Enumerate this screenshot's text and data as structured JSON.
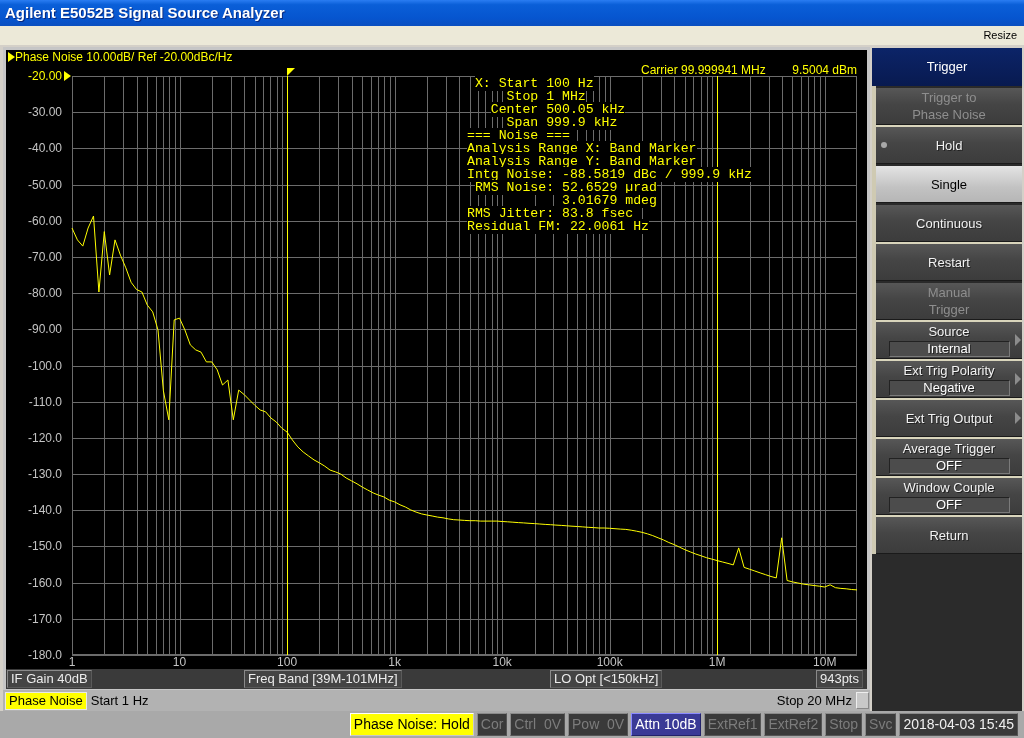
{
  "window": {
    "title": "Agilent E5052B Signal Source Analyzer"
  },
  "menu_bar": {
    "items": [
      "Resize"
    ]
  },
  "chart_panel": {
    "carrier": {
      "frequency": "Carrier 99.999941 MHz",
      "power": "9.5004 dBm"
    },
    "chart_data": {
      "type": "line",
      "title": "Phase Noise 10.00dB/ Ref -20.00dBc/Hz",
      "grid": true,
      "categories": [
        "1",
        null,
        null,
        null,
        null,
        null,
        null,
        null,
        null,
        null,
        null,
        null,
        null,
        null,
        null,
        null,
        null,
        null,
        null,
        null,
        "10",
        null,
        null,
        null,
        null,
        null,
        null,
        null,
        null,
        null,
        null,
        null,
        null,
        null,
        null,
        null,
        null,
        null,
        null,
        null,
        "100",
        null,
        null,
        null,
        null,
        null,
        null,
        null,
        null,
        null,
        null,
        null,
        null,
        null,
        null,
        null,
        null,
        null,
        null,
        null,
        "1k",
        null,
        null,
        null,
        null,
        null,
        null,
        null,
        null,
        null,
        null,
        null,
        null,
        null,
        null,
        null,
        null,
        null,
        null,
        null,
        "10k",
        null,
        null,
        null,
        null,
        null,
        null,
        null,
        null,
        null,
        null,
        null,
        null,
        null,
        null,
        null,
        null,
        null,
        null,
        null,
        "100k",
        null,
        null,
        null,
        null,
        null,
        null,
        null,
        null,
        null,
        null,
        null,
        null,
        null,
        null,
        null,
        null,
        null,
        null,
        null,
        "1M",
        null,
        null,
        null,
        null,
        null,
        null,
        null,
        null,
        null,
        null,
        null,
        null,
        null,
        null,
        null,
        null,
        null,
        null,
        null,
        "10M",
        null,
        null,
        null,
        null,
        null,
        null
      ],
      "series": [
        {
          "color": "#ffff00",
          "values": [
            -62,
            -65.3,
            -67,
            -62,
            -58.7,
            -79.7,
            -63,
            -75,
            -65.3,
            -69.5,
            -73,
            -77,
            -79,
            -79.7,
            -83.3,
            -85.2,
            -90.2,
            -107,
            -115,
            -87.4,
            -86.9,
            -90.2,
            -94.3,
            -95.7,
            -96.3,
            -99,
            -99,
            -101.2,
            -105.4,
            -104,
            -115,
            -106.8,
            -108,
            -109.5,
            -111,
            -112.3,
            -112.8,
            -114.5,
            -115.6,
            -117.3,
            -118.4,
            -120.6,
            -122.5,
            -123.9,
            -125,
            -126.1,
            -126.9,
            -127.8,
            -128.9,
            -129.4,
            -130,
            -131.1,
            -131.9,
            -132.7,
            -133.6,
            -134.4,
            -135.2,
            -135.8,
            -136.3,
            -137.2,
            -137.7,
            -138.5,
            -139.1,
            -139.9,
            -140.5,
            -141,
            -141.3,
            -141.6,
            -141.9,
            -142.1,
            -142.4,
            -142.6,
            -142.7,
            -142.8,
            -142.9,
            -142.9,
            -143,
            -143,
            -143,
            -143,
            -143.1,
            -143.2,
            -143.3,
            -143.4,
            -143.5,
            -143.6,
            -143.7,
            -143.8,
            -143.9,
            -144,
            -144.1,
            -144.2,
            -144.3,
            -144.4,
            -144.5,
            -144.6,
            -144.7,
            -144.8,
            -144.9,
            -144.9,
            -145,
            -145.1,
            -145.2,
            -145.3,
            -145.5,
            -145.8,
            -146.1,
            -146.5,
            -147,
            -147.6,
            -148.2,
            -148.9,
            -149.5,
            -150.2,
            -150.9,
            -151.5,
            -152.1,
            -152.6,
            -153.1,
            -153.5,
            -153.9,
            -154.3,
            -154.7,
            -155.1,
            -150.4,
            -155.8,
            -156.3,
            -156.8,
            -157.3,
            -157.8,
            -158.3,
            -158.7,
            -147.6,
            -159.4,
            -159.8,
            -160.1,
            -160.4,
            -160.6,
            -160.8,
            -161,
            -161.2,
            -160.6,
            -161.4,
            -161.6,
            -161.7,
            -161.9,
            -162
          ]
        }
      ],
      "ylim": [
        -180,
        -20
      ],
      "yticks": [
        {
          "value": -20,
          "label": "-20.00"
        },
        {
          "value": -30,
          "label": "-30.00"
        },
        {
          "value": -40,
          "label": "-40.00"
        },
        {
          "value": -50,
          "label": "-50.00"
        },
        {
          "value": -60,
          "label": "-60.00"
        },
        {
          "value": -70,
          "label": "-70.00"
        },
        {
          "value": -80,
          "label": "-80.00"
        },
        {
          "value": -90,
          "label": "-90.00"
        },
        {
          "value": -100,
          "label": "-100.0"
        },
        {
          "value": -110,
          "label": "-110.0"
        },
        {
          "value": -120,
          "label": "-120.0"
        },
        {
          "value": -130,
          "label": "-130.0"
        },
        {
          "value": -140,
          "label": "-140.0"
        },
        {
          "value": -150,
          "label": "-150.0"
        },
        {
          "value": -160,
          "label": "-160.0"
        },
        {
          "value": -170,
          "label": "-170.0"
        },
        {
          "value": -180,
          "label": "-180.0"
        }
      ],
      "ref_lines": [
        {
          "axis": "x",
          "value": "100"
        },
        {
          "axis": "x",
          "value": "1M"
        }
      ]
    },
    "analysis_readout": [
      " X: Start 100 Hz",
      "     Stop 1 MHz",
      "   Center 500.05 kHz",
      "     Span 999.9 kHz",
      "=== Noise ===",
      "Analysis Range X: Band Marker",
      "Analysis Range Y: Band Marker",
      "Intg Noise: -88.5819 dBc / 999.9 kHz",
      " RMS Noise: 52.6529 µrad",
      "            3.01679 mdeg",
      "RMS Jitter: 83.8 fsec",
      "Residual FM: 22.0061 Hz"
    ],
    "info_bar": [
      "IF Gain 40dB",
      "Freq Band [39M-101MHz]",
      "LO Opt [<150kHz]",
      "943pts"
    ],
    "sweep_bar": {
      "trace_label": "Phase Noise",
      "start": "Start 1 Hz",
      "stop": "Stop 20 MHz"
    }
  },
  "softkeys": {
    "title": "Trigger",
    "items": [
      {
        "label": "Trigger to\nPhase Noise",
        "kind": "button",
        "disabled": true,
        "selected": false,
        "current": false,
        "submenu": false,
        "group_start": false
      },
      {
        "label": "Hold",
        "kind": "button",
        "disabled": false,
        "selected": false,
        "current": true,
        "submenu": false,
        "group_start": true
      },
      {
        "label": "Single",
        "kind": "button",
        "disabled": false,
        "selected": true,
        "current": false,
        "submenu": false,
        "group_start": false
      },
      {
        "label": "Continuous",
        "kind": "button",
        "disabled": false,
        "selected": false,
        "current": false,
        "submenu": false,
        "group_start": false
      },
      {
        "label": "Restart",
        "kind": "button",
        "disabled": false,
        "selected": false,
        "current": false,
        "submenu": false,
        "group_start": true
      },
      {
        "label": "Manual\nTrigger",
        "kind": "button",
        "disabled": true,
        "selected": false,
        "current": false,
        "submenu": false,
        "group_start": false
      },
      {
        "label": "Source",
        "kind": "setting",
        "value": "Internal",
        "disabled": false,
        "selected": false,
        "current": false,
        "submenu": true,
        "group_start": true
      },
      {
        "label": "Ext Trig Polarity",
        "kind": "setting",
        "value": "Negative",
        "disabled": false,
        "selected": false,
        "current": false,
        "submenu": true,
        "group_start": true
      },
      {
        "label": "Ext Trig Output",
        "kind": "button",
        "disabled": false,
        "selected": false,
        "current": false,
        "submenu": true,
        "group_start": true
      },
      {
        "label": "Average Trigger",
        "kind": "setting",
        "value": "OFF",
        "disabled": false,
        "selected": false,
        "current": false,
        "submenu": false,
        "group_start": true
      },
      {
        "label": "Window Couple",
        "kind": "setting",
        "value": "OFF",
        "disabled": false,
        "selected": false,
        "current": false,
        "submenu": false,
        "group_start": true
      },
      {
        "label": "Return",
        "kind": "button",
        "disabled": false,
        "selected": false,
        "current": false,
        "submenu": false,
        "group_start": true
      }
    ]
  },
  "status_bar": [
    {
      "text": "Phase Noise: Hold",
      "kind": "highlight"
    },
    {
      "text": "Cor",
      "kind": "dim"
    },
    {
      "text": "Ctrl  0V",
      "kind": "dim"
    },
    {
      "text": "Pow  0V",
      "kind": "dim"
    },
    {
      "text": "Attn 10dB",
      "kind": "info"
    },
    {
      "text": "ExtRef1",
      "kind": "dim"
    },
    {
      "text": "ExtRef2",
      "kind": "dim"
    },
    {
      "text": "Stop",
      "kind": "dim"
    },
    {
      "text": "Svc",
      "kind": "dim"
    },
    {
      "text": "2018-04-03 15:45",
      "kind": "clock"
    }
  ]
}
